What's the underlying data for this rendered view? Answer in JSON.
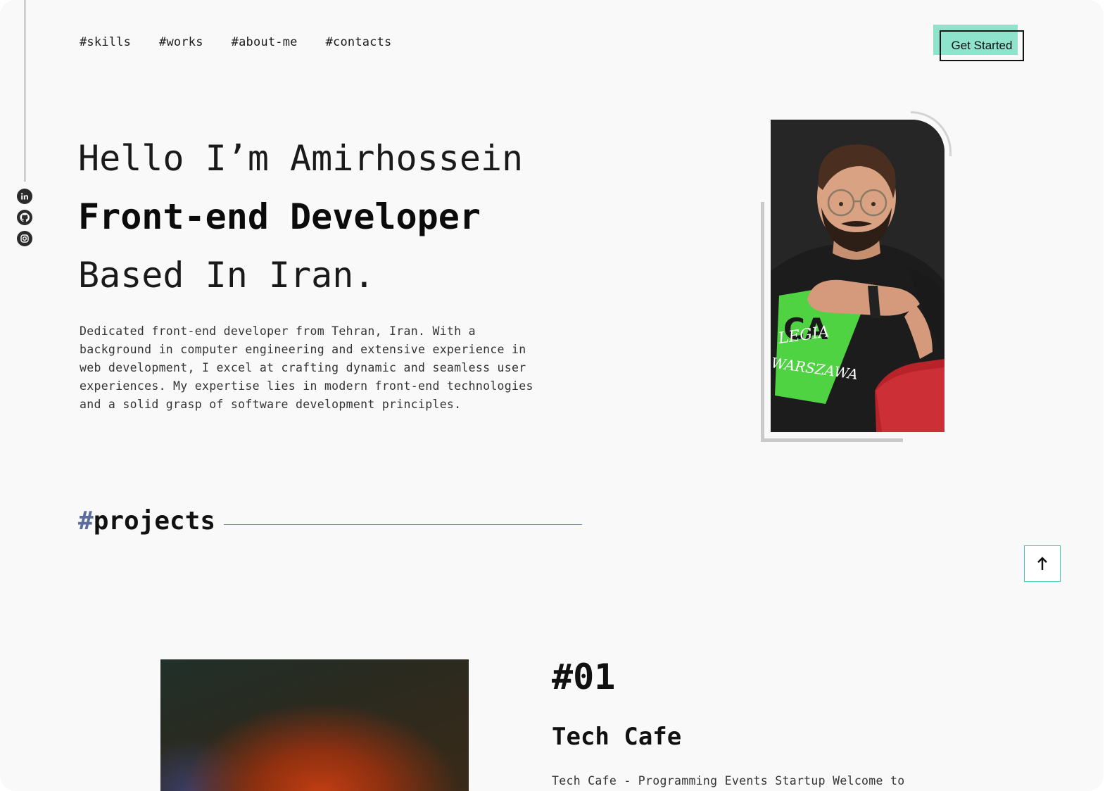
{
  "nav": {
    "items": [
      "#skills",
      "#works",
      "#about-me",
      "#contacts"
    ],
    "cta_label": "Get Started"
  },
  "social": [
    "linkedin-icon",
    "github-icon",
    "instagram-icon"
  ],
  "hero": {
    "line1": "Hello I’m Amirhossein",
    "line2": "Front-end Developer",
    "line3": "Based In Iran.",
    "bio": "Dedicated front-end developer from Tehran, Iran. With a background in computer engineering and extensive experience in web development, I excel at crafting dynamic and seamless user experiences. My expertise lies in modern front-end technologies and a solid grasp of software development principles.",
    "shirt_text": [
      "CA",
      "LEGIA",
      "WARSZAWA"
    ]
  },
  "projects": {
    "heading_hash": "#",
    "heading_word": "projects",
    "items": [
      {
        "number": "#01",
        "name": "Tech Cafe",
        "description": "Tech Cafe - Programming Events Startup Welcome to"
      }
    ]
  },
  "scroll_top_glyph": "↑",
  "colors": {
    "accent_mint": "#8de3cb",
    "accent_teal": "#3cc9a8",
    "accent_blue": "#5a6d9e",
    "background": "#f9f9f9"
  }
}
